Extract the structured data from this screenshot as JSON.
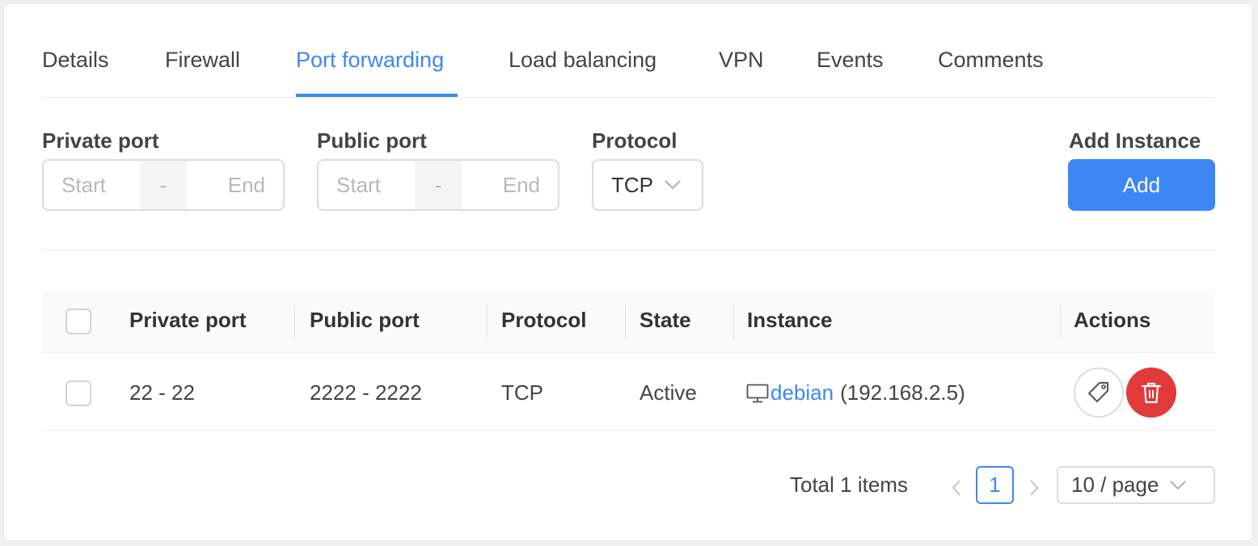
{
  "tabs": [
    {
      "label": "Details"
    },
    {
      "label": "Firewall"
    },
    {
      "label": "Port forwarding",
      "active": true
    },
    {
      "label": "Load balancing"
    },
    {
      "label": "VPN"
    },
    {
      "label": "Events"
    },
    {
      "label": "Comments"
    }
  ],
  "form": {
    "private_port": {
      "label": "Private port",
      "start_placeholder": "Start",
      "separator": "-",
      "end_placeholder": "End"
    },
    "public_port": {
      "label": "Public port",
      "start_placeholder": "Start",
      "separator": "-",
      "end_placeholder": "End"
    },
    "protocol": {
      "label": "Protocol",
      "value": "TCP"
    },
    "add_instance": {
      "label": "Add Instance",
      "button": "Add"
    }
  },
  "table": {
    "columns": [
      "Private port",
      "Public port",
      "Protocol",
      "State",
      "Instance",
      "Actions"
    ],
    "rows": [
      {
        "private_port": "22 - 22",
        "public_port": "2222 - 2222",
        "protocol": "TCP",
        "state": "Active",
        "instance_name": "debian",
        "instance_ip": "(192.168.2.5)",
        "actions": [
          "tag-icon",
          "delete-icon"
        ]
      }
    ]
  },
  "pagination": {
    "total": "Total 1 items",
    "current_page": "1",
    "page_size": "10 / page"
  },
  "colors": {
    "accent": "#3d87f5",
    "danger": "#e03a3a"
  }
}
